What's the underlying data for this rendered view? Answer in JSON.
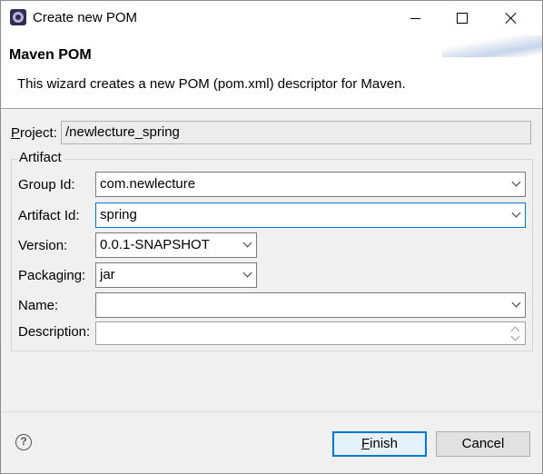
{
  "window": {
    "title": "Create new POM"
  },
  "header": {
    "title": "Maven POM",
    "description": "This wizard creates a new POM (pom.xml) descriptor for Maven."
  },
  "form": {
    "project_label_mnemonic": "P",
    "project_label_rest": "roject:",
    "project_value": "/newlecture_spring",
    "artifact_group_label": "Artifact",
    "group_id_label": "Group Id:",
    "group_id_value": "com.newlecture",
    "artifact_id_label": "Artifact Id:",
    "artifact_id_value": "spring",
    "version_label": "Version:",
    "version_value": "0.0.1-SNAPSHOT",
    "packaging_label": "Packaging:",
    "packaging_value": "jar",
    "name_label": "Name:",
    "name_value": "",
    "description_label": "Description:",
    "description_value": ""
  },
  "buttons": {
    "help_glyph": "?",
    "finish_mnemonic": "F",
    "finish_rest": "inish",
    "cancel_label": "Cancel"
  },
  "colors": {
    "focus_accent": "#0078d7",
    "dialog_background": "#f0f0f0"
  }
}
